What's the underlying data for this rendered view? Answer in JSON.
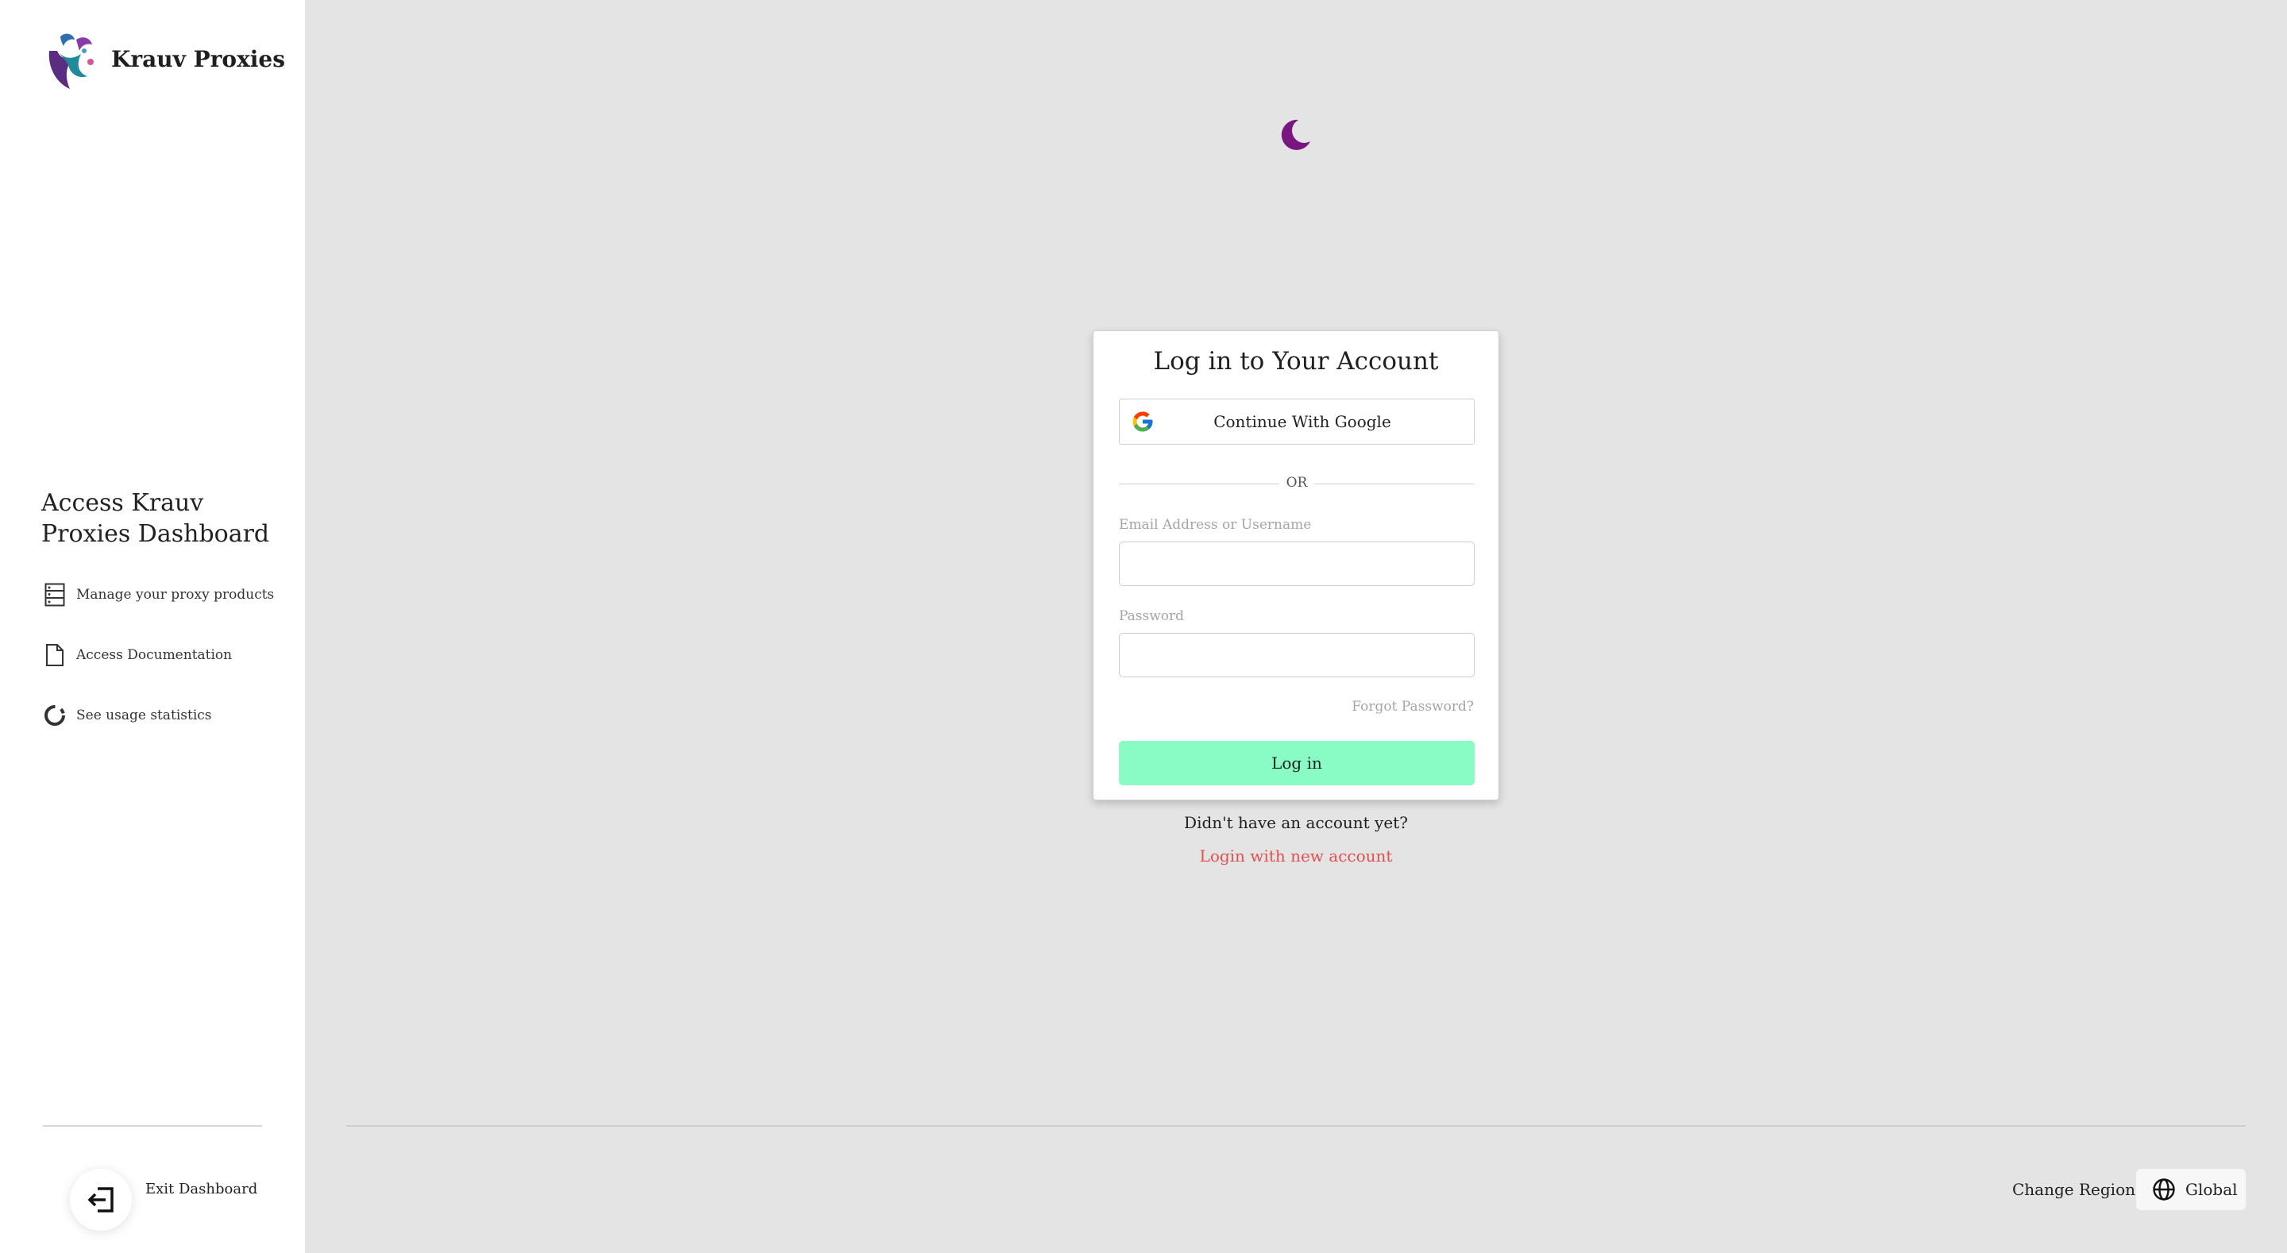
{
  "brand": {
    "name": "Krauv Proxies",
    "logo_icon": "krauv-logo-icon"
  },
  "sidebar": {
    "heading": "Access Krauv Proxies Dashboard",
    "features": [
      {
        "label": "Manage your proxy products",
        "icon": "server-list-icon"
      },
      {
        "label": "Access Documentation",
        "icon": "document-icon"
      },
      {
        "label": "See usage statistics",
        "icon": "donut-chart-icon"
      }
    ],
    "exit_label": "Exit Dashboard"
  },
  "theme_toggle": {
    "icon": "moon-icon",
    "color": "#7a167f"
  },
  "login": {
    "title": "Log in to Your Account",
    "google_label": "Continue With Google",
    "or_label": "OR",
    "email_label": "Email Address or Username",
    "email_value": "",
    "password_label": "Password",
    "password_value": "",
    "forgot_label": "Forgot Password?",
    "submit_label": "Log in",
    "submit_color": "#88fcc4"
  },
  "signup": {
    "prompt": "Didn't have an account yet?",
    "link": "Login with new account",
    "link_color": "#e24f4f"
  },
  "footer": {
    "region_label": "Change Region",
    "region_value": "Global",
    "region_icon": "globe-icon"
  }
}
